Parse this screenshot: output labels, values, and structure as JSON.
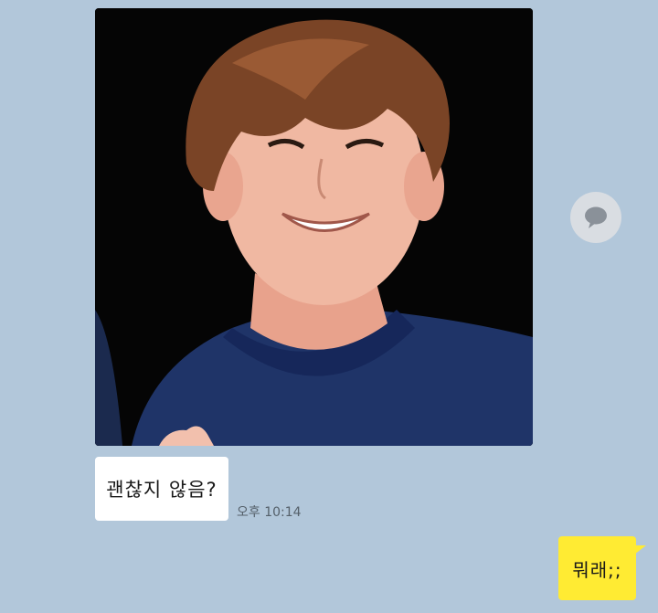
{
  "chat": {
    "received_image": {
      "alt": "",
      "icon": "photo-of-smiling-person"
    },
    "share_button_icon": "speech-bubble-icon",
    "received_message": {
      "text": "괜찮지 않음?",
      "time": "오후 10:14"
    },
    "sent_message": {
      "text": "뭐래;;"
    }
  },
  "colors": {
    "background": "#b2c7da",
    "received_bubble": "#ffffff",
    "sent_bubble": "#ffeb33",
    "share_button": "#d9dde2"
  }
}
